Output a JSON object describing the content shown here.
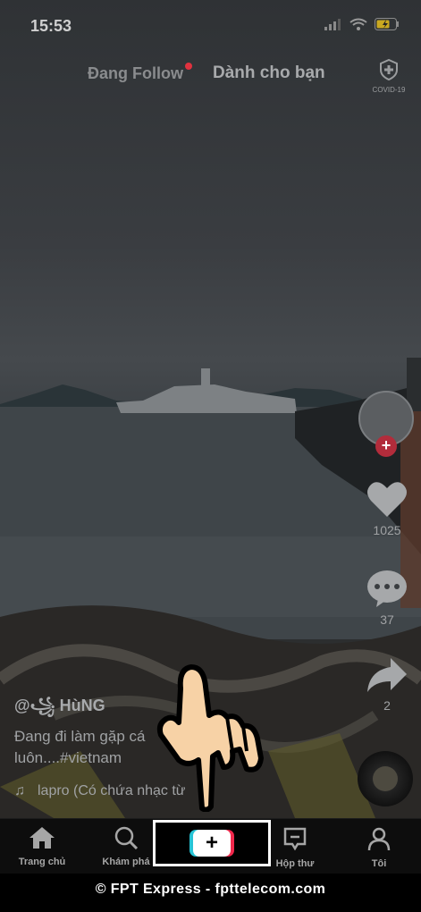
{
  "status_bar": {
    "time": "15:53"
  },
  "top_tabs": {
    "following": "Đang Follow",
    "for_you": "Dành cho bạn",
    "covid_label": "COVID-19"
  },
  "right_rail": {
    "likes": "1025",
    "comments": "37",
    "shares": "2"
  },
  "video_info": {
    "username": "@꧁ HùNG",
    "caption": "Đang đi làm gặp cá luôn....#vietnam",
    "music": "lapro (Có chứa nhạc từ"
  },
  "bottom_nav": {
    "home": "Trang chủ",
    "discover": "Khám phá",
    "create": "+",
    "inbox": "Hộp thư",
    "profile": "Tôi"
  },
  "watermark": "© FPT Express - fpttelecom.com",
  "colors": {
    "create_cyan": "#27c4d6",
    "create_red": "#f0284c",
    "avatar_plus": "#b22c3b",
    "hand_skin": "#f7d2a6"
  },
  "icons": [
    "signal-icon",
    "wifi-icon",
    "battery-icon",
    "shield-icon",
    "heart-icon",
    "comment-icon",
    "share-icon",
    "music-note-icon",
    "home-icon",
    "search-icon",
    "inbox-icon",
    "profile-icon",
    "hand-pointer-icon"
  ]
}
